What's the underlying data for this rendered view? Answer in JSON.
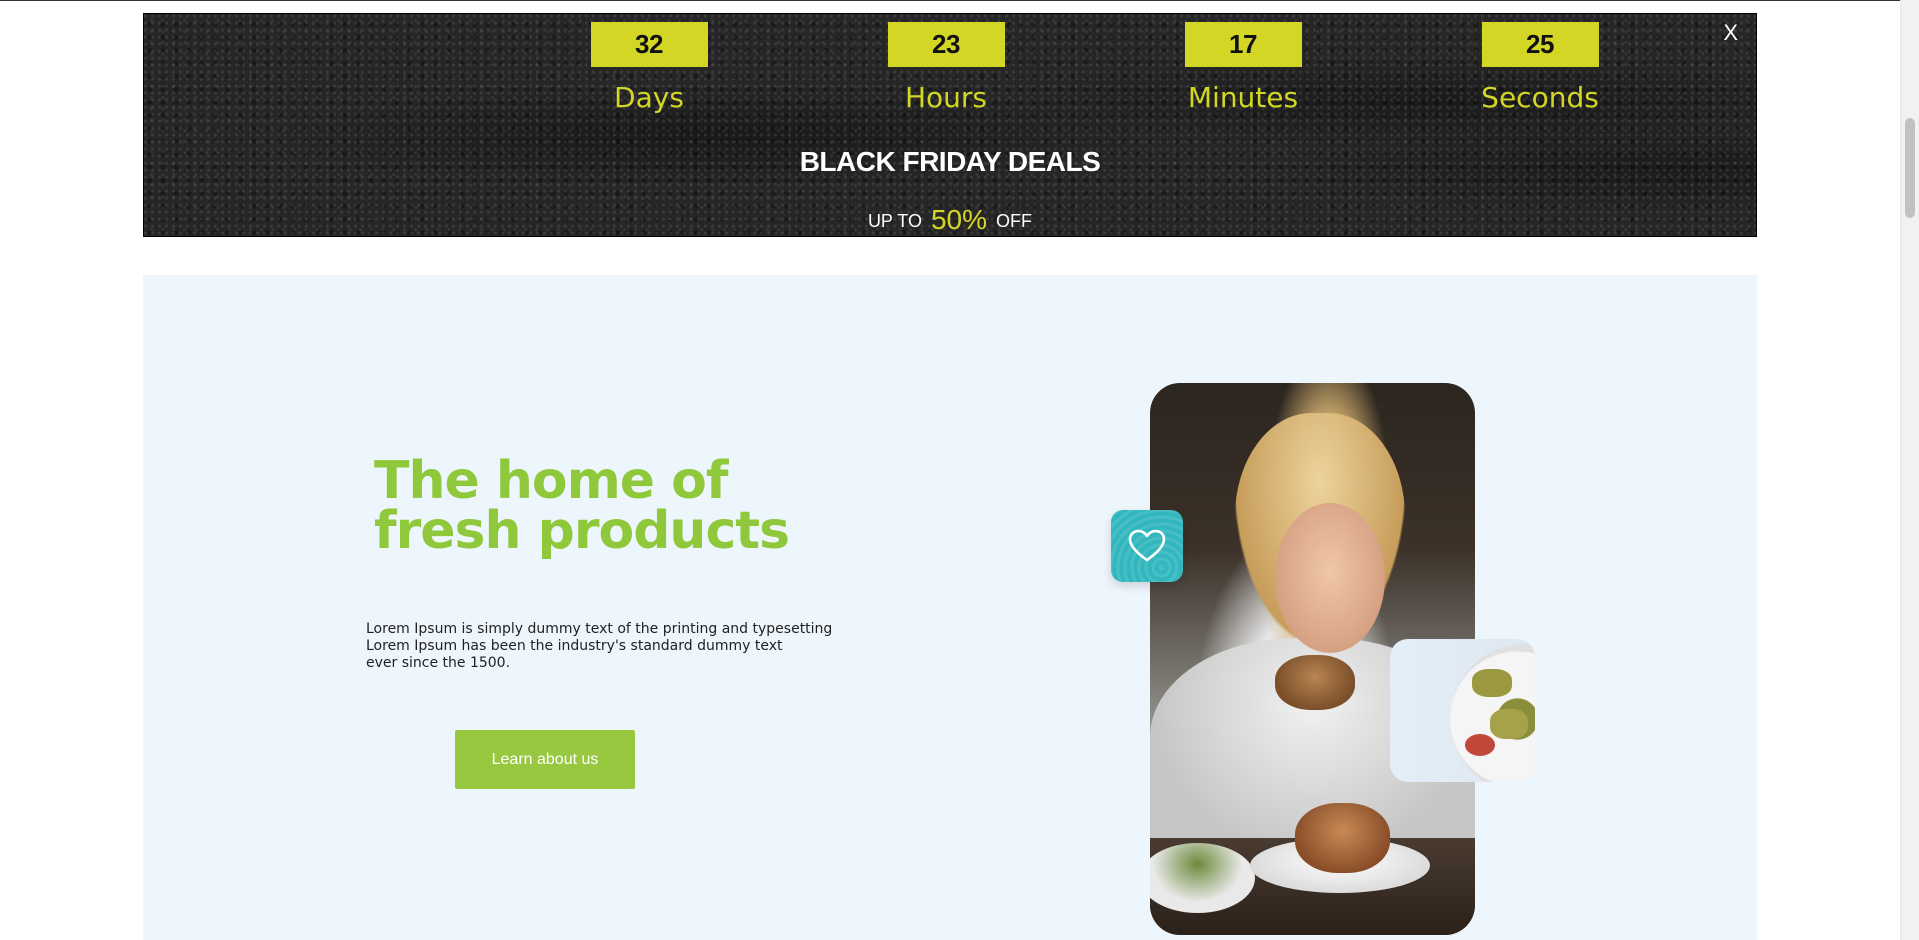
{
  "countdown": {
    "units": [
      {
        "value": "32",
        "label": "Days"
      },
      {
        "value": "23",
        "label": "Hours"
      },
      {
        "value": "17",
        "label": "Minutes"
      },
      {
        "value": "25",
        "label": "Seconds"
      }
    ],
    "title": "BLACK FRIDAY DEALS",
    "offer_prefix": "UP TO",
    "offer_percent": "50%",
    "offer_suffix": "OFF",
    "close_label": "X",
    "accent_color": "#d4d626"
  },
  "hero": {
    "title_line1": "The home of",
    "title_line2": "fresh products",
    "description_lines": [
      "Lorem Ipsum is simply dummy text of the printing and typesetting",
      "Lorem Ipsum has been the industry's standard dummy text",
      "ever since the 1500."
    ],
    "button_label": "Learn about us",
    "title_color": "#8fc83a",
    "button_color": "#98c840",
    "background_color": "#eef6fd",
    "badge_icon": "heart-icon",
    "badge_color": "#33b7be"
  }
}
